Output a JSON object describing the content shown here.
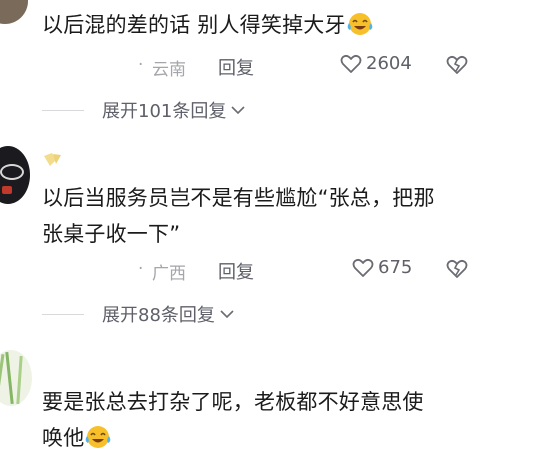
{
  "comments": [
    {
      "text": "以后混的差的话 别人得笑掉大牙",
      "location": "云南",
      "reply_label": "回复",
      "likes": "2604"
    },
    {
      "text_line1": "以后当服务员岂不是有些尴尬“张总，把那",
      "text_line2": "张桌子收一下”",
      "location": "广西",
      "reply_label": "回复",
      "likes": "675"
    },
    {
      "text_line1": "要是张总去打杂了呢，老板都不好意思使",
      "text_line2": "唤他"
    }
  ],
  "expands": [
    {
      "label": "展开101条回复"
    },
    {
      "label": "展开88条回复"
    }
  ],
  "dot": "·",
  "icons": {
    "like": "heart-outline-icon",
    "dislike": "broken-heart-icon",
    "emoji": "laughing-tears-emoji",
    "chevron": "chevron-down-icon"
  }
}
